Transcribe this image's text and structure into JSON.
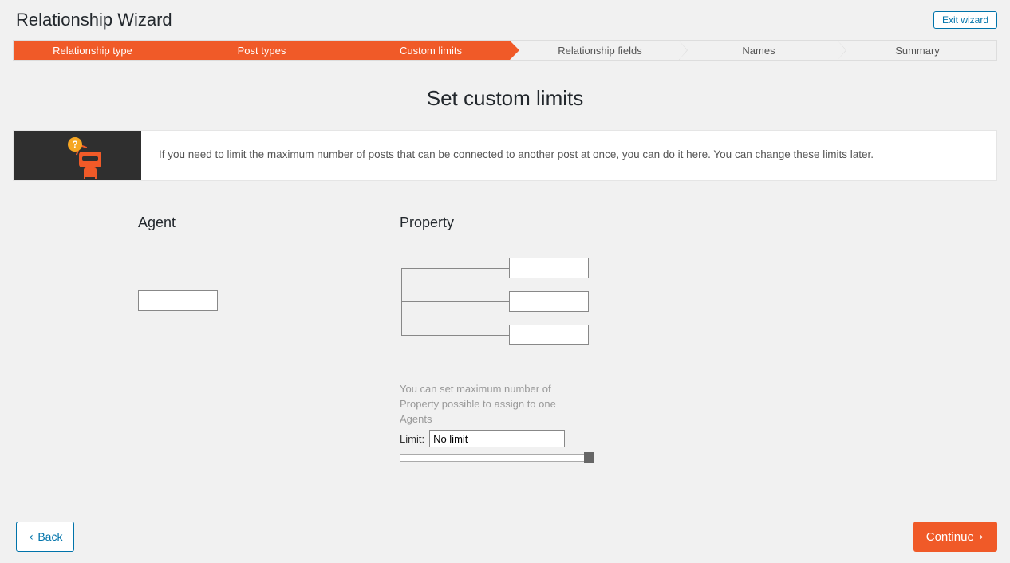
{
  "header": {
    "title": "Relationship Wizard",
    "exit_label": "Exit wizard"
  },
  "steps": [
    {
      "label": "Relationship type",
      "active": true
    },
    {
      "label": "Post types",
      "active": true
    },
    {
      "label": "Custom limits",
      "active": true
    },
    {
      "label": "Relationship fields",
      "active": false
    },
    {
      "label": "Names",
      "active": false
    },
    {
      "label": "Summary",
      "active": false
    }
  ],
  "main": {
    "heading": "Set custom limits",
    "info_text": "If you need to limit the maximum number of posts that can be connected to another post at once, you can do it here. You can change these limits later."
  },
  "diagram": {
    "left_label": "Agent",
    "right_label": "Property",
    "help_text": "You can set maximum number of Property possible to assign to one Agents",
    "limit_label": "Limit:",
    "limit_value": "No limit"
  },
  "footer": {
    "back_label": "Back",
    "continue_label": "Continue"
  },
  "icons": {
    "chev_left": "‹",
    "chev_right": "›",
    "question": "?"
  }
}
